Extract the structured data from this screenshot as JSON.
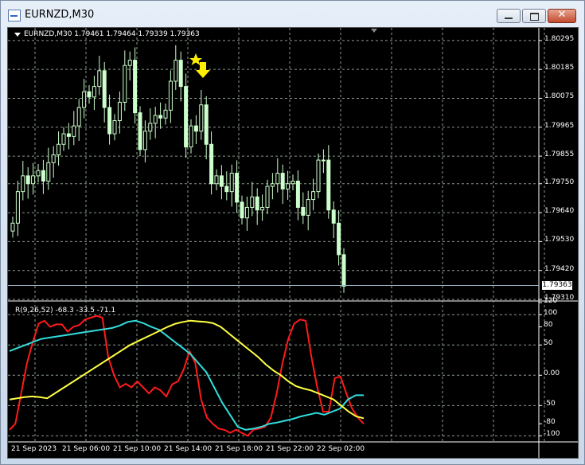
{
  "window": {
    "title": "EURNZD,M30",
    "close_symbol": "✕"
  },
  "chart": {
    "info": "EURNZD,M30  1.79461 1.79464 1.79339 1.79363",
    "current_price_label": "1.79363",
    "price_ticks": [
      "1.80295",
      "1.80185",
      "1.80075",
      "1.79965",
      "1.79855",
      "1.79750",
      "1.79640",
      "1.79530",
      "1.79420",
      "1.79310"
    ],
    "time_ticks": [
      "21 Sep 2023",
      "21 Sep 06:00",
      "21 Sep 10:00",
      "21 Sep 14:00",
      "21 Sep 18:00",
      "21 Sep 22:00",
      "22 Sep 02:00"
    ],
    "indicator_label": "R(9,26,52) -68.3 -33.5 -71.1",
    "indicator_ticks": [
      "120",
      "100",
      "80",
      "50",
      "0.00",
      "-50",
      "-80",
      "-100"
    ],
    "colors": {
      "background": "#000000",
      "candle": "#ccffcc",
      "grid": "#8a9a8a",
      "red": "#ff1a1a",
      "cyan": "#33dddd",
      "yellow": "#ffff44",
      "signal": "#ffee00"
    },
    "icons": [
      "star-icon",
      "down-arrow-icon"
    ]
  },
  "chart_data": {
    "type": "candlestick",
    "symbol": "EURNZD",
    "timeframe": "M30",
    "ohlc_last": {
      "open": 1.79461,
      "high": 1.79464,
      "low": 1.79339,
      "close": 1.79363
    },
    "ylim": [
      1.7931,
      1.8034
    ],
    "closes": [
      1.796,
      1.7972,
      1.7978,
      1.7975,
      1.7978,
      1.798,
      1.7976,
      1.7983,
      1.7986,
      1.799,
      1.7994,
      1.7993,
      1.7997,
      1.8004,
      1.801,
      1.8008,
      1.8012,
      1.8018,
      1.8004,
      1.7994,
      1.7999,
      1.8006,
      1.802,
      1.8022,
      1.8002,
      1.7988,
      1.7995,
      1.7998,
      1.8001,
      1.8,
      1.8003,
      1.8014,
      1.8022,
      1.8012,
      1.7989,
      1.7997,
      1.7995,
      1.8005,
      1.799,
      1.7975,
      1.7978,
      1.7974,
      1.7972,
      1.7979,
      1.7968,
      1.7962,
      1.7966,
      1.797,
      1.7965,
      1.7966,
      1.7974,
      1.7975,
      1.7979,
      1.7973,
      1.7975,
      1.7976,
      1.7966,
      1.7963,
      1.7969,
      1.7972,
      1.7984,
      1.7984,
      1.7965,
      1.796,
      1.7948,
      1.7936
    ],
    "indicator": {
      "name": "R(9,26,52)",
      "values": [
        -68.3,
        -33.5,
        -71.1
      ],
      "ylim": [
        -110,
        120
      ],
      "series": [
        {
          "color": "red",
          "values": [
            -90,
            -80,
            -30,
            20,
            55,
            85,
            90,
            80,
            84,
            84,
            72,
            80,
            83,
            92,
            95,
            98,
            95,
            30,
            0,
            -20,
            -14,
            -20,
            -10,
            -20,
            -30,
            -20,
            -25,
            -35,
            -15,
            -10,
            10,
            40,
            20,
            -40,
            -70,
            -80,
            -88,
            -90,
            -95,
            -90,
            -95,
            -100,
            -90,
            -88,
            -85,
            -70,
            -30,
            20,
            60,
            85,
            92,
            90,
            30,
            -20,
            -60,
            -60,
            -5,
            -2,
            -30,
            -55,
            -70,
            -80
          ]
        },
        {
          "color": "cyan",
          "values": [
            40,
            45,
            50,
            55,
            60,
            62,
            64,
            66,
            68,
            70,
            72,
            74,
            76,
            78,
            82,
            88,
            90,
            86,
            80,
            75,
            65,
            55,
            45,
            35,
            20,
            5,
            -20,
            -45,
            -65,
            -85,
            -90,
            -88,
            -85,
            -80,
            -78,
            -75,
            -72,
            -68,
            -65,
            -62,
            -65,
            -60,
            -55,
            -40,
            -33,
            -33
          ]
        },
        {
          "color": "yellow",
          "values": [
            -40,
            -38,
            -36,
            -35,
            -36,
            -38,
            -30,
            -22,
            -14,
            -6,
            2,
            10,
            18,
            26,
            34,
            42,
            50,
            56,
            62,
            68,
            74,
            80,
            85,
            88,
            90,
            89,
            88,
            86,
            80,
            70,
            60,
            50,
            40,
            30,
            18,
            8,
            0,
            -10,
            -18,
            -22,
            -25,
            -30,
            -35,
            -40,
            -50,
            -60,
            -68,
            -71
          ]
        }
      ]
    }
  }
}
